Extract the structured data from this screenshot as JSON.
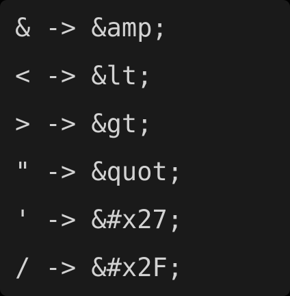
{
  "editor": {
    "text_color": "#d2d2d2",
    "background_color": "#1a1a1a",
    "lines": [
      "& -> &amp;",
      "< -> &lt;",
      "> -> &gt;",
      "\" -> &quot;",
      "' -> &#x27;",
      "/ -> &#x2F;"
    ]
  }
}
